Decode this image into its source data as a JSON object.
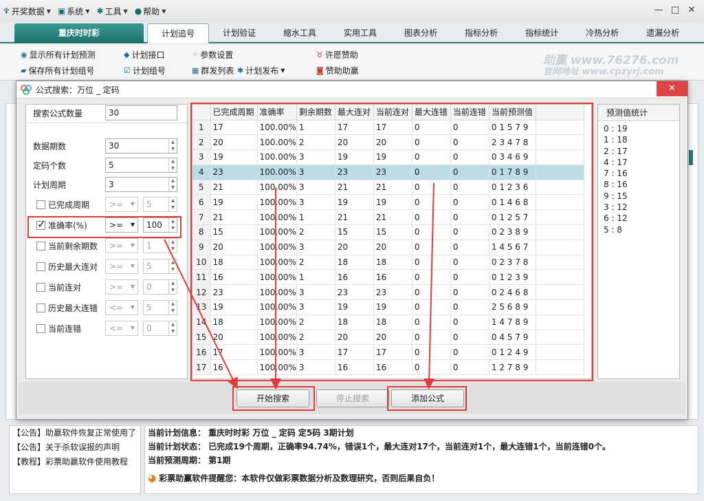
{
  "menubar": {
    "items": [
      "开奖数据",
      "系统",
      "工具",
      "帮助"
    ]
  },
  "window_controls": {
    "minimize": "—",
    "maximize": "□",
    "close": "✕"
  },
  "main_tab": "重庆时时彩",
  "tabs": [
    "计划追号",
    "计划验证",
    "缩水工具",
    "实用工具",
    "图表分析",
    "指标分析",
    "指标统计",
    "冷热分析",
    "遗漏分析"
  ],
  "toolbar": {
    "show_all": "显示所有计划预测",
    "save_all": "保存所有计划组号",
    "plan_api": "计划接口",
    "plan_group": "计划组号",
    "params": "参数设置",
    "bulk_list": "群发列表",
    "plan_publish": "计划发布",
    "wish": "许愿赞助",
    "sponsor": "赞助助赢",
    "brand1": "助赢 www.76276.com",
    "brand2": "官网地址 www.cpzyrj.com"
  },
  "dialog": {
    "title": "公式搜索：万位 _ 定码",
    "close": "✕",
    "form": {
      "search_count_label": "搜索公式数量",
      "search_count": "30",
      "data_periods_label": "数据期数",
      "data_periods": "30",
      "fixed_count_label": "定码个数",
      "fixed_count": "5",
      "plan_cycle_label": "计划周期",
      "plan_cycle": "3",
      "completed_label": "已完成周期",
      "completed_op": ">=",
      "completed_val": "5",
      "accuracy_label": "准确率(%)",
      "accuracy_op": ">=",
      "accuracy_val": "100",
      "remain_label": "当前剩余期数",
      "remain_op": ">=",
      "remain_val": "1",
      "hist_max_hit_label": "历史最大连对",
      "hist_max_hit_op": ">=",
      "hist_max_hit_val": "5",
      "cur_hit_label": "当前连对",
      "cur_hit_op": ">=",
      "cur_hit_val": "0",
      "hist_max_miss_label": "历史最大连错",
      "hist_max_miss_op": "<=",
      "hist_max_miss_val": "5",
      "cur_miss_label": "当前连错",
      "cur_miss_op": "<=",
      "cur_miss_val": "0"
    },
    "table": {
      "headers": [
        "",
        "已完成周期",
        "准确率",
        "剩余期数",
        "最大连对",
        "当前连对",
        "最大连错",
        "当前连错",
        "当前预测值"
      ],
      "rows": [
        [
          "1",
          "17",
          "100.00%",
          "1",
          "17",
          "17",
          "0",
          "0",
          "0 1 5 7 9"
        ],
        [
          "2",
          "20",
          "100.00%",
          "2",
          "20",
          "20",
          "0",
          "0",
          "2 3 4 7 8"
        ],
        [
          "3",
          "19",
          "100.00%",
          "3",
          "19",
          "19",
          "0",
          "0",
          "0 3 4 6 9"
        ],
        [
          "4",
          "23",
          "100.00%",
          "3",
          "23",
          "23",
          "0",
          "0",
          "0 1 7 8 9"
        ],
        [
          "5",
          "21",
          "100.00%",
          "3",
          "21",
          "21",
          "0",
          "0",
          "0 1 2 3 6"
        ],
        [
          "6",
          "19",
          "100.00%",
          "3",
          "19",
          "19",
          "0",
          "0",
          "0 1 4 6 8"
        ],
        [
          "7",
          "21",
          "100.00%",
          "1",
          "21",
          "21",
          "0",
          "0",
          "0 1 2 5 7"
        ],
        [
          "8",
          "15",
          "100.00%",
          "2",
          "15",
          "15",
          "0",
          "0",
          "0 2 3 8 9"
        ],
        [
          "9",
          "20",
          "100.00%",
          "3",
          "20",
          "20",
          "0",
          "0",
          "1 4 5 6 7"
        ],
        [
          "10",
          "18",
          "100.00%",
          "2",
          "18",
          "18",
          "0",
          "0",
          "0 2 3 7 8"
        ],
        [
          "11",
          "16",
          "100.00%",
          "1",
          "16",
          "16",
          "0",
          "0",
          "0 1 2 3 9"
        ],
        [
          "12",
          "23",
          "100.00%",
          "3",
          "23",
          "23",
          "0",
          "0",
          "0 2 4 6 8"
        ],
        [
          "13",
          "19",
          "100.00%",
          "3",
          "19",
          "19",
          "0",
          "0",
          "2 5 6 8 9"
        ],
        [
          "14",
          "18",
          "100.00%",
          "2",
          "18",
          "18",
          "0",
          "0",
          "1 4 7 8 9"
        ],
        [
          "15",
          "20",
          "100.00%",
          "2",
          "20",
          "20",
          "0",
          "0",
          "0 4 5 7 9"
        ],
        [
          "16",
          "17",
          "100.00%",
          "3",
          "17",
          "17",
          "0",
          "0",
          "0 1 2 4 9"
        ],
        [
          "17",
          "16",
          "100.00%",
          "3",
          "16",
          "16",
          "0",
          "0",
          "1 2 7 8 9"
        ]
      ],
      "selected_row": 4
    },
    "stats": {
      "title": "预测值统计",
      "items": [
        "0 : 19",
        "1 : 18",
        "2 : 17",
        "4 : 17",
        "7 : 16",
        "8 : 16",
        "9 : 15",
        "3 : 12",
        "6 : 12",
        "5 : 8"
      ]
    },
    "buttons": {
      "start": "开始搜索",
      "stop": "停止搜索",
      "add": "添加公式"
    }
  },
  "notices": [
    "【公告】助赢软件恢复正常使用了",
    "【公告】关于杀软误报的声明",
    "【教程】彩票助赢软件使用教程"
  ],
  "info": {
    "line1": "当前计划信息：  重庆时时彩    万位 _ 定码    定5码    3期计划",
    "line2": "当前计划状态：  已完成19个周期，正确率94.74%，错误1个，最大连对17个，当前连对1个，最大连错1个，当前连错0个。",
    "line3": "当前预测周期：  第1期",
    "line4": "彩票助赢软件提醒您：本软件仅做彩票数据分析及数理研究，否则后果自负！"
  }
}
